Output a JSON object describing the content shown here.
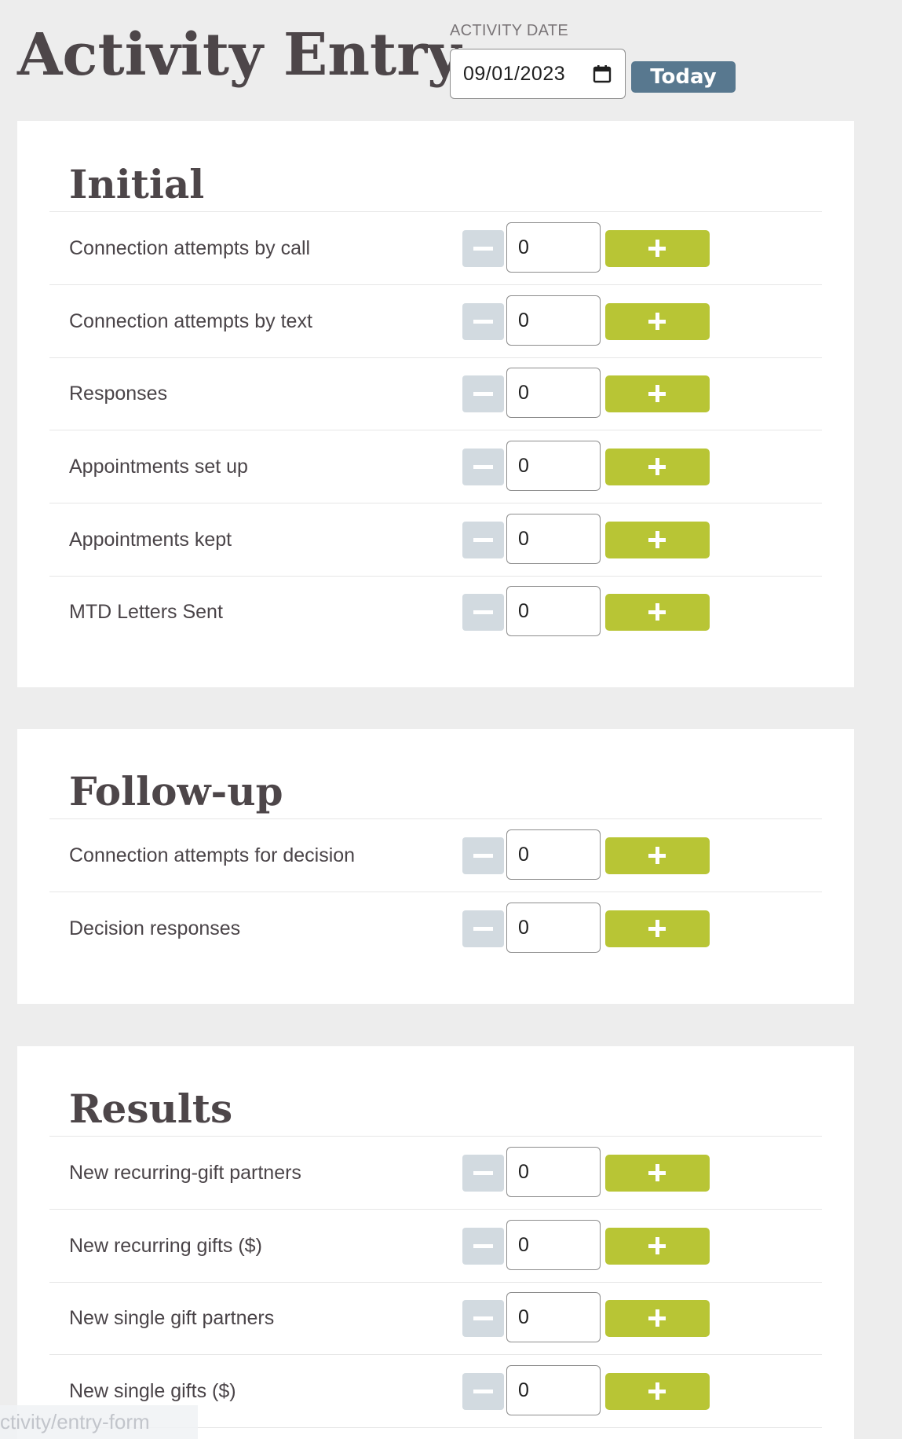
{
  "page": {
    "title": "Activity Entry"
  },
  "activity_date": {
    "label": "ACTIVITY DATE",
    "value": "09/01/2023",
    "today_label": "Today"
  },
  "sections": [
    {
      "title": "Initial",
      "rows": [
        {
          "label": "Connection attempts by call",
          "value": "0"
        },
        {
          "label": "Connection attempts by text",
          "value": "0"
        },
        {
          "label": "Responses",
          "value": "0"
        },
        {
          "label": "Appointments set up",
          "value": "0"
        },
        {
          "label": "Appointments kept",
          "value": "0"
        },
        {
          "label": "MTD Letters Sent",
          "value": "0"
        }
      ]
    },
    {
      "title": "Follow-up",
      "rows": [
        {
          "label": "Connection attempts for decision",
          "value": "0"
        },
        {
          "label": "Decision responses",
          "value": "0"
        }
      ]
    },
    {
      "title": "Results",
      "rows": [
        {
          "label": "New recurring-gift partners",
          "value": "0"
        },
        {
          "label": "New recurring gifts ($)",
          "value": "0"
        },
        {
          "label": "New single gift partners",
          "value": "0"
        },
        {
          "label": "New single gifts ($)",
          "value": "0"
        }
      ]
    }
  ],
  "status_bar": {
    "url_text": "ctivity/entry-form"
  },
  "icons": {
    "calendar": "calendar-icon",
    "minus": "minus-icon",
    "plus": "plus-icon"
  },
  "colors": {
    "page_background": "#ededed",
    "panel_background": "#ffffff",
    "heading_text": "#4d4649",
    "today_button": "#58788f",
    "increment_button": "#b8c535",
    "decrement_button": "#d2dae0"
  }
}
